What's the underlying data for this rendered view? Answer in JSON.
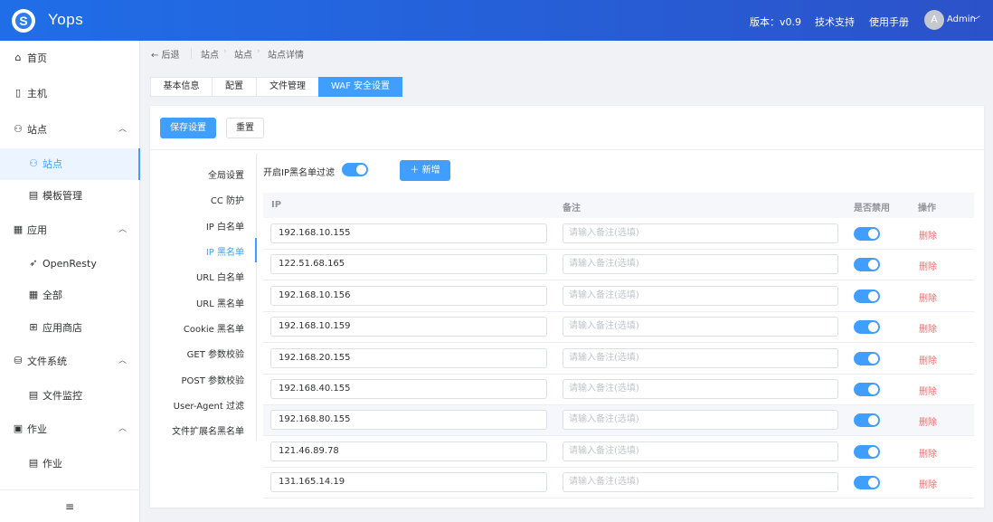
{
  "header": {
    "app_name": "Yops",
    "logo_letter": "S",
    "version": "版本：v0.9",
    "support": "技术支持",
    "manual": "使用手册",
    "avatar_letter": "A",
    "user": "Admin"
  },
  "sidebar": {
    "items": [
      {
        "label": "首页",
        "icon": "home-icon",
        "glyph": "⌂"
      },
      {
        "label": "主机",
        "icon": "server-icon",
        "glyph": "▯"
      },
      {
        "label": "站点",
        "icon": "sitemap-icon",
        "glyph": "⚇"
      },
      {
        "label": "站点",
        "icon": "sitemap-icon",
        "glyph": "⚇"
      },
      {
        "label": "模板管理",
        "icon": "template-icon",
        "glyph": "▤"
      },
      {
        "label": "应用",
        "icon": "apps-icon",
        "glyph": "▦"
      },
      {
        "label": "OpenResty",
        "icon": "bird-icon",
        "glyph": "➶"
      },
      {
        "label": "全部",
        "icon": "grid-icon",
        "glyph": "▦"
      },
      {
        "label": "应用商店",
        "icon": "store-icon",
        "glyph": "⊞"
      },
      {
        "label": "文件系统",
        "icon": "drive-icon",
        "glyph": "⛁"
      },
      {
        "label": "文件监控",
        "icon": "file-icon",
        "glyph": "▤"
      },
      {
        "label": "作业",
        "icon": "job-icon",
        "glyph": "▣"
      },
      {
        "label": "作业",
        "icon": "job-icon",
        "glyph": "▤"
      }
    ],
    "collapse_glyph": "≡"
  },
  "breadcrumb": {
    "back": "← 后退",
    "crumbs": [
      "站点",
      "站点",
      "站点详情"
    ]
  },
  "tabs": [
    "基本信息",
    "配置",
    "文件管理",
    "WAF 安全设置"
  ],
  "actions": {
    "save": "保存设置",
    "reset": "重置"
  },
  "waf_menu": [
    "全局设置",
    "CC 防护",
    "IP 白名单",
    "IP 黑名单",
    "URL 白名单",
    "URL 黑名单",
    "Cookie 黑名单",
    "GET 参数校验",
    "POST 参数校验",
    "User-Agent 过滤",
    "文件扩展名黑名单"
  ],
  "blacklist": {
    "toggle_label": "开启IP黑名单过滤",
    "add_button": "＋ 新增",
    "columns": [
      "IP",
      "备注",
      "是否禁用",
      "操作"
    ],
    "note_placeholder": "请输入备注(选填)",
    "delete_label": "删除",
    "rows": [
      {
        "ip": "192.168.10.155",
        "enabled": true
      },
      {
        "ip": "122.51.68.165",
        "enabled": true
      },
      {
        "ip": "192.168.10.156",
        "enabled": true
      },
      {
        "ip": "192.168.10.159",
        "enabled": true
      },
      {
        "ip": "192.168.20.155",
        "enabled": true
      },
      {
        "ip": "192.168.40.155",
        "enabled": true
      },
      {
        "ip": "192.168.80.155",
        "enabled": true
      },
      {
        "ip": "121.46.89.78",
        "enabled": true
      },
      {
        "ip": "131.165.14.19",
        "enabled": true
      }
    ]
  },
  "colors": {
    "primary": "#409eff",
    "danger": "#f56c6c",
    "header_start": "#1f6ee8",
    "header_end": "#2c52c9"
  }
}
